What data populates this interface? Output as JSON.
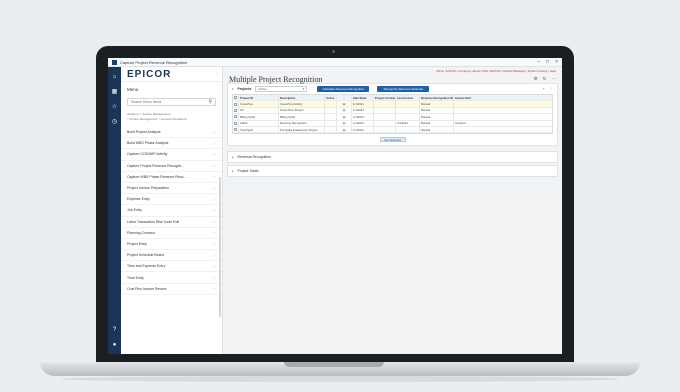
{
  "window": {
    "title": "Capture Project Revenue Recognition",
    "controls": [
      "–",
      "□",
      "×"
    ]
  },
  "brand": {
    "logo_text": "EPICOR"
  },
  "sidebar": {
    "heading": "Menu",
    "search_placeholder": "Search Menu Items",
    "breadcrumb": [
      "All Menu > Service Management",
      "> Project Management > General Operations"
    ],
    "items": [
      {
        "label": "Build Project Analysis"
      },
      {
        "label": "Build WBS Phase Analysis"
      },
      {
        "label": "Capture COS/WIP Activity"
      },
      {
        "label": "Capture Project Revenue Recognit..."
      },
      {
        "label": "Capture WBS Phase Revenue Reco..."
      },
      {
        "label": "Project Invoice Preparation"
      },
      {
        "label": "Expense Entry"
      },
      {
        "label": "Job Entry"
      },
      {
        "label": "Labor Transaction Risk Code Edit"
      },
      {
        "label": "Planning Contract"
      },
      {
        "label": "Project Entry"
      },
      {
        "label": "Project Schedule Board"
      },
      {
        "label": "Time and Expense Entry"
      },
      {
        "label": "Time Entry"
      },
      {
        "label": "Cost Plus Invoice Review"
      }
    ]
  },
  "main": {
    "title": "Multiple Project Recognition",
    "top_links": [
      "Menu: 8.04.00 | Company: Epicor USA | EPIC03 | Default Manager | Option Groups | Help"
    ],
    "projects_section": {
      "label": "Projects",
      "select_value": "Active",
      "buttons": [
        "Calculate Revenue Recognition",
        "Recognize Revenue Selected"
      ]
    },
    "grid": {
      "columns": [
        "Project ID",
        "Description",
        "Active",
        "",
        "Start Date",
        "Project Contract",
        "Last Invoice",
        "Revenue Recognition Me...",
        "Invoice Stat"
      ],
      "rows": [
        [
          "Cost+Plus",
          "Cost+Plus Activity",
          "",
          "▤",
          "1/1/2021",
          "",
          "",
          "Manual",
          ""
        ],
        [
          "FP",
          "Fixed Price Project",
          "",
          "▤",
          "1/1/2021",
          "",
          "",
          "Manual",
          ""
        ],
        [
          "Billing Study",
          "Billing Study",
          "",
          "▤",
          "1/1/2021",
          "",
          "",
          "Manual",
          ""
        ],
        [
          "Adhoc",
          "Revenue Recognition",
          "",
          "▤",
          "1/1/2021",
          "",
          "4/1/2021",
          "Manual",
          "Invoiced"
        ],
        [
          "Training01",
          "Pre-Sales Enablement Project",
          "",
          "▤",
          "1/1/2021",
          "",
          "",
          "Manual",
          ""
        ]
      ],
      "footer_button": "Get Selected"
    },
    "panels": [
      "Revenue Recognition",
      "Project Totals"
    ]
  },
  "colors": {
    "brand": "#1b3556",
    "accent": "#1e5fa8",
    "background": "#eaeef1"
  }
}
